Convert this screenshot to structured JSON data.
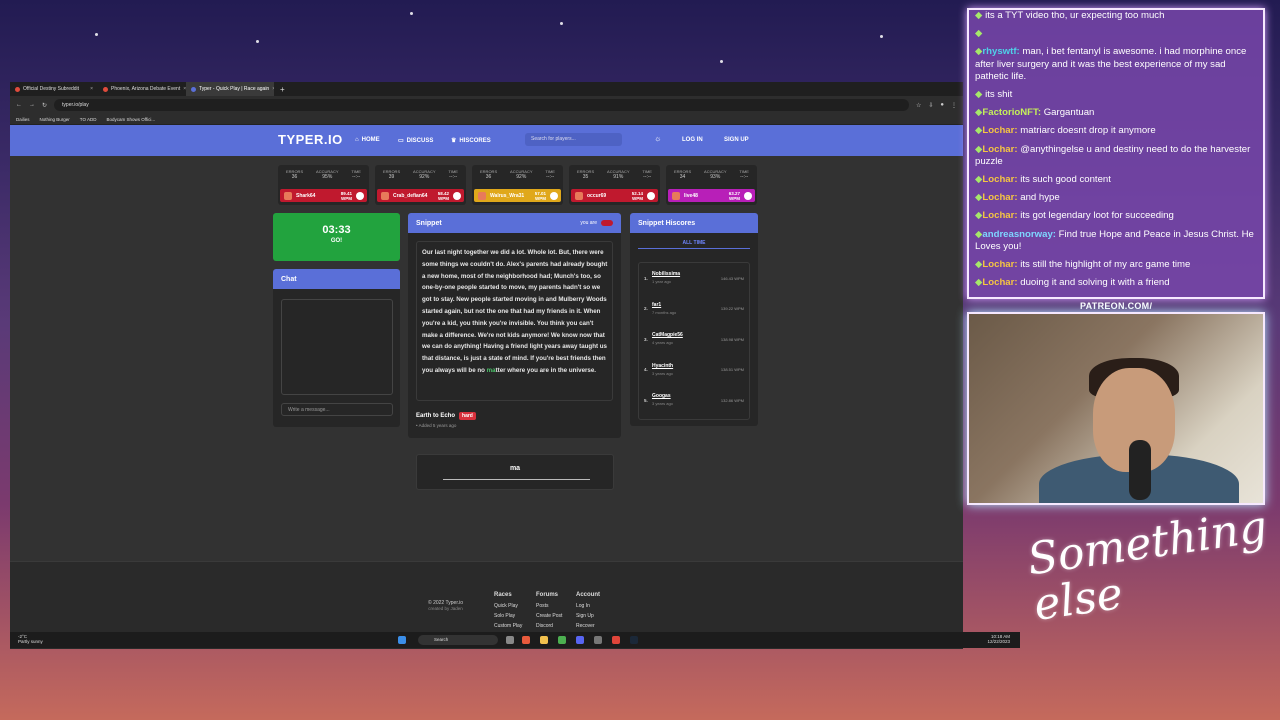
{
  "browser": {
    "tabs": [
      {
        "label": "Official Destiny Subreddit"
      },
      {
        "label": "Phoenix, Arizona Debate Event"
      },
      {
        "label": "Typer - Quick Play | Race again"
      }
    ],
    "url": "typer.io/play",
    "bookmarks": [
      "Dailies",
      "Nothing Burger",
      "TO ADD",
      "Bodycam Shows Offici..."
    ]
  },
  "site": {
    "logo": "TYPER.IO",
    "nav": {
      "home": "HOME",
      "discuss": "DISCUSS",
      "hiscores": "HISCORES",
      "search_placeholder": "Search for players...",
      "login": "LOG IN",
      "signup": "SIGN UP"
    },
    "stat_labels": {
      "errors": "ERRORS",
      "accuracy": "ACCURACY",
      "time": "TIME",
      "wpm": "WPM"
    },
    "racers": [
      {
        "name": "Shark64",
        "errors": "36",
        "accuracy": "95%",
        "time": "--:--",
        "wpm": "89.41",
        "color": "#c0192e"
      },
      {
        "name": "Crab_defian64",
        "errors": "39",
        "accuracy": "92%",
        "time": "--:--",
        "wpm": "58.42",
        "color": "#c0192e"
      },
      {
        "name": "Walrus_Wra31",
        "errors": "36",
        "accuracy": "92%",
        "time": "--:--",
        "wpm": "57.01",
        "color": "#e0a81b"
      },
      {
        "name": "occur69",
        "errors": "35",
        "accuracy": "91%",
        "time": "--:--",
        "wpm": "52.14",
        "color": "#c0192e"
      },
      {
        "name": "live48",
        "errors": "34",
        "accuracy": "93%",
        "time": "--:--",
        "wpm": "63.27",
        "color": "#b81fb8"
      }
    ],
    "timer": {
      "value": "03:33",
      "status": "GO!"
    },
    "chat": {
      "title": "Chat",
      "placeholder": "Write a message..."
    },
    "snippet": {
      "title": "Snippet",
      "you_are": "you are",
      "text_before": "Our last night together we did a lot. Whole lot. But, there were some things we couldn't do. Alex's parents had already bought a new home, most of the neighborhood had; Munch's too, so one-by-one people started to move, my parents hadn't so we got to stay. New people started moving in and Mulberry Woods started again, but not the one that had my friends in it. When you're a kid, you think you're invisible. You think you can't make a difference. We're not kids anymore! We know now that we can do anything! Having a friend light years away taught us that distance, is just a state of mind. If you're best friends then you always will be no ",
      "text_done": "ma",
      "text_after": "tter where you are in the universe.",
      "source": "Earth to Echo",
      "difficulty": "hard",
      "added": "• Added 5 years ago",
      "typed": "ma"
    },
    "hiscores": {
      "title": "Snippet Hiscores",
      "filter": "ALL TIME",
      "rows": [
        {
          "rank": "1.",
          "name": "Nobilissima",
          "ago": "1 year ago",
          "wpm": "146.43 WPM"
        },
        {
          "rank": "2.",
          "name": "far1",
          "ago": "7 months ago",
          "wpm": "139.22 WPM"
        },
        {
          "rank": "3.",
          "name": "CatMagpie56",
          "ago": "4 years ago",
          "wpm": "138.98 WPM"
        },
        {
          "rank": "4.",
          "name": "Hyacinth",
          "ago": "3 years ago",
          "wpm": "138.51 WPM"
        },
        {
          "rank": "5.",
          "name": "Googas",
          "ago": "3 years ago",
          "wpm": "132.86 WPM"
        }
      ]
    },
    "footer": {
      "copyright": "© 2022 Typer.io",
      "created_by": "created by Jaden",
      "races": {
        "title": "Races",
        "links": [
          "Quick Play",
          "Solo Play",
          "Custom Play"
        ]
      },
      "forums": {
        "title": "Forums",
        "links": [
          "Posts",
          "Create Post",
          "Discord"
        ]
      },
      "account": {
        "title": "Account",
        "links": [
          "Log In",
          "Sign Up",
          "Recover"
        ]
      }
    }
  },
  "taskbar": {
    "weather_temp": "-2°C",
    "weather_desc": "Partly sunny",
    "search": "Search",
    "time": "10:18 AM",
    "date": "12/22/2023"
  },
  "stream_chat": [
    {
      "user": "",
      "text": "its a TYT video tho, ur expecting too much"
    },
    {
      "user": "",
      "text": ""
    },
    {
      "user": "rhyswtf:",
      "text": "man, i bet fentanyl is awesome. i had morphine once after liver surgery and it was the best experience of my sad pathetic life."
    },
    {
      "user": "",
      "text": "its shit"
    },
    {
      "user": "FactorioNFT:",
      "text": "Gargantuan"
    },
    {
      "user": "Lochar:",
      "text": "matriarc doesnt drop it anymore"
    },
    {
      "user": "Lochar:",
      "text": "@anythingelse u and destiny need to do the harvester puzzle"
    },
    {
      "user": "Lochar:",
      "text": "its such good content"
    },
    {
      "user": "Lochar:",
      "text": "and hype"
    },
    {
      "user": "Lochar:",
      "text": "its got legendary loot for succeeding"
    },
    {
      "user": "andreasnorway:",
      "text": "Find true Hope and Peace in Jesus Christ. He Loves you!"
    },
    {
      "user": "Lochar:",
      "text": "its still the highlight of my arc game time"
    },
    {
      "user": "Lochar:",
      "text": "duoing it and solving it with a friend"
    }
  ],
  "overlay": {
    "patreon": "PATREON.COM/",
    "brand": "Something else"
  }
}
